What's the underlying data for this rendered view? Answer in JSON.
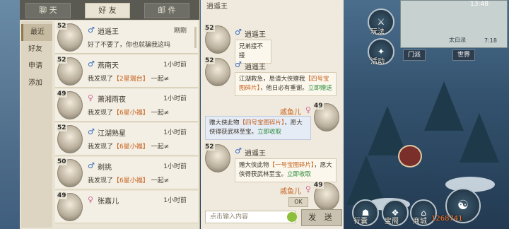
{
  "friend_panel": {
    "tabs": [
      "聊 天",
      "好 友",
      "邮 件"
    ],
    "active_tab": 1,
    "categories": [
      "最近",
      "好友",
      "申请",
      "添加"
    ],
    "active_category": 0,
    "friends": [
      {
        "level": "52",
        "gender": "male",
        "name": "逍遥王",
        "time": "刚刚",
        "message": "好了不要了，你也就骗我这吗",
        "highlight": ""
      },
      {
        "level": "52",
        "gender": "male",
        "name": "燕南天",
        "time": "1小时前",
        "message": "我发现了",
        "highlight": "【2星瑞台】",
        "tail": " 一起≠"
      },
      {
        "level": "49",
        "gender": "female",
        "name": "萧湘雨夜",
        "time": "1小时前",
        "message": "我发现了",
        "highlight": "【6星小福】",
        "tail": " 一起≠"
      },
      {
        "level": "52",
        "gender": "male",
        "name": "江湖熟星",
        "time": "1小时前",
        "message": "我发现了",
        "highlight": "【6星小福】",
        "tail": " 一起≠"
      },
      {
        "level": "50",
        "gender": "male",
        "name": "剃挑",
        "time": "1小时前",
        "message": "我发现了",
        "highlight": "【6星小福】",
        "tail": " 一起≠"
      },
      {
        "level": "49",
        "gender": "female",
        "name": "张嘉儿",
        "time": "1小时前",
        "message": "",
        "highlight": ""
      }
    ]
  },
  "chat": {
    "title": "逍遥王",
    "messages": [
      {
        "side": "left",
        "level": "52",
        "name": "逍遥王",
        "text": "兄弟接不接"
      },
      {
        "side": "left",
        "level": "52",
        "name": "逍遥王",
        "pre": "江湖救急，恳请大侠赠我",
        "hl": "【四号宝图碎片】",
        "post": "，他日必有重谢。",
        "link": "立即赠送"
      },
      {
        "side": "right",
        "level": "49",
        "name": "戚鱼儿",
        "pre": "赠大侠此物",
        "hl": "【四号宝图碎片】",
        "post": "，愿大侠得获武林至宝。",
        "link": "立即收取"
      },
      {
        "side": "left",
        "level": "52",
        "name": "逍遥王",
        "pre": "赠大侠此物",
        "hl": "【一号宝图碎片】",
        "post": "，愿大侠得获武林至宝。",
        "link": "立即收取"
      },
      {
        "side": "right",
        "level": "49",
        "name": "戚鱼儿",
        "text": "OK"
      }
    ],
    "input_placeholder": "点击输入内容",
    "send_label": "发 送"
  },
  "hud": {
    "time": "13:48",
    "minimap_coords": "7:18",
    "minimap_place": "太白派",
    "buttons": [
      {
        "label": "玩法",
        "icon": "battle-icon"
      },
      {
        "label": "活动",
        "icon": "event-icon"
      },
      {
        "label": "门派",
        "icon": "sect-icon"
      },
      {
        "label": "世界",
        "icon": "world-icon"
      },
      {
        "label": "商城",
        "icon": "shop-icon"
      },
      {
        "label": "行囊",
        "icon": "bag-icon"
      },
      {
        "label": "宝阁",
        "icon": "treasure-icon"
      }
    ],
    "power": "1268741"
  },
  "colors": {
    "panel_bg": "#e9e3d3",
    "highlight_orange": "#c7621f",
    "link_green": "#2d8b3b",
    "male_blue": "#3b6fc1",
    "female_pink": "#d26a9a"
  }
}
